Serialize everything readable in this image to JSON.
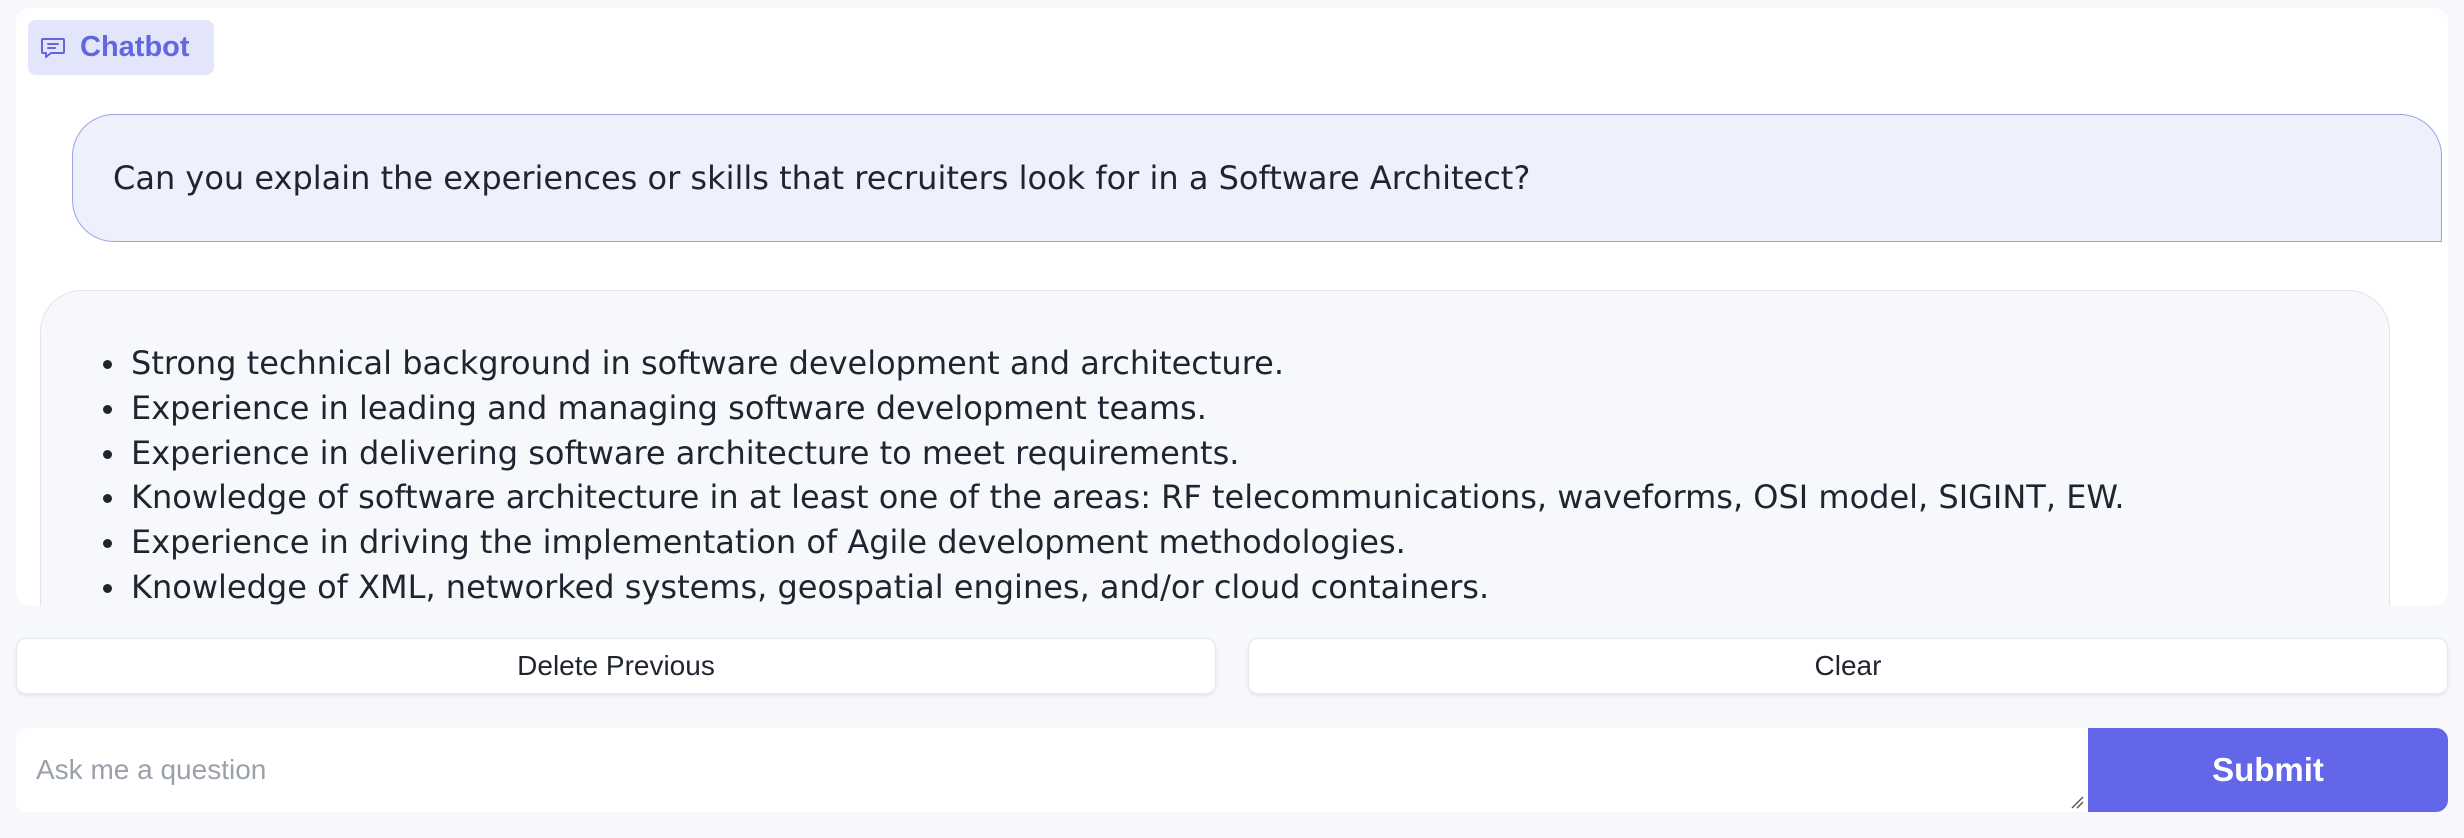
{
  "chatbot": {
    "label": "Chatbot",
    "icon": "chat-bubble-icon",
    "accent_color": "#6366e1"
  },
  "messages": {
    "user": "Can you explain the experiences or skills that recruiters look for in a Software Architect?",
    "bot_items": [
      "Strong technical background in software development and architecture.",
      "Experience in leading and managing software development teams.",
      "Experience in delivering software architecture to meet requirements.",
      "Knowledge of software architecture in at least one of the areas: RF telecommunications, waveforms, OSI model, SIGINT, EW.",
      "Experience in driving the implementation of Agile development methodologies.",
      "Knowledge of XML, networked systems, geospatial engines, and/or cloud containers."
    ]
  },
  "buttons": {
    "delete_previous": "Delete Previous",
    "clear": "Clear",
    "submit": "Submit"
  },
  "input": {
    "placeholder": "Ask me a question",
    "value": ""
  },
  "colors": {
    "submit_bg": "#6366e9",
    "user_bubble_bg": "#eef0fc",
    "user_bubble_border": "#9aa3ea"
  }
}
